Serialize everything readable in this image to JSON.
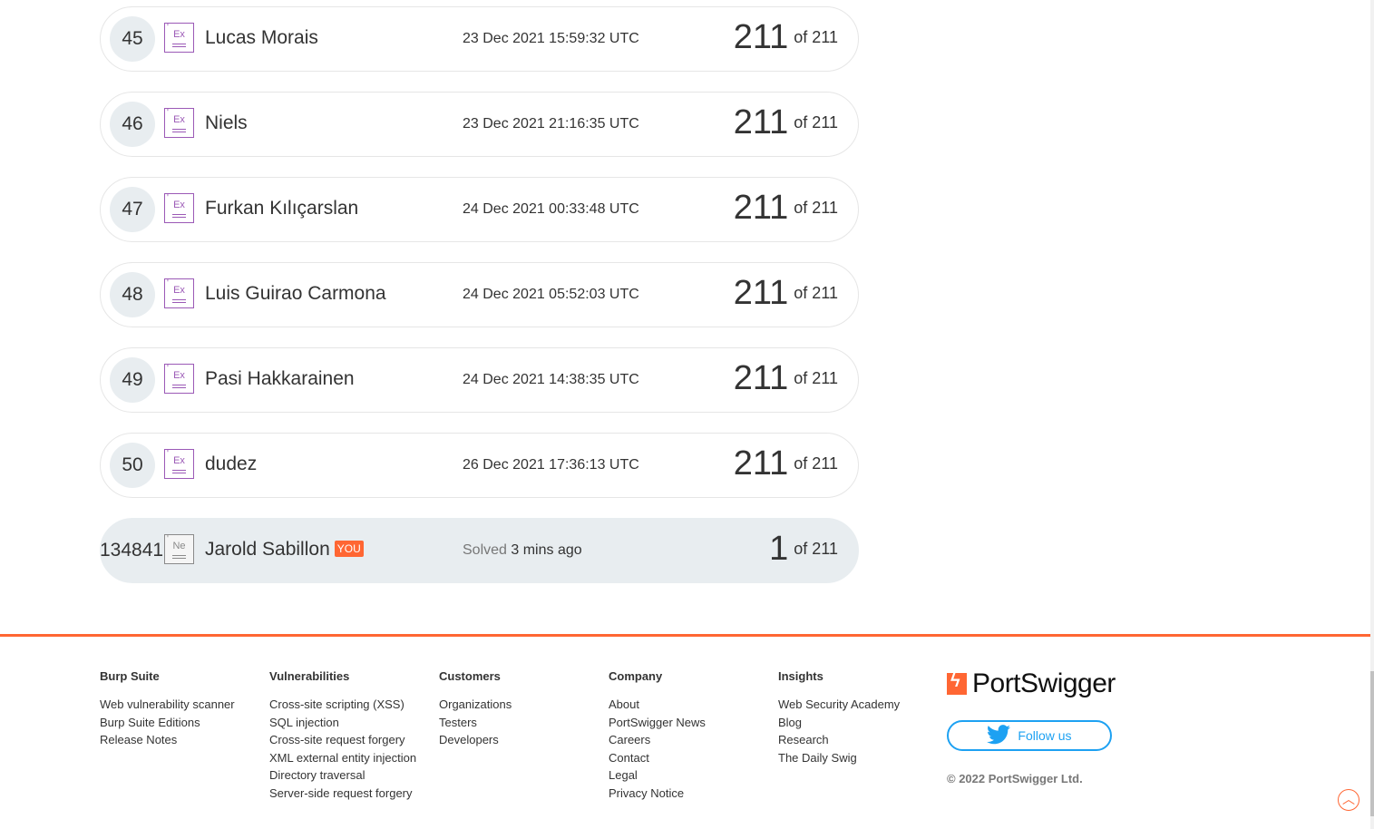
{
  "leaderboard": {
    "rows": [
      {
        "rank": "45",
        "level": "Ex",
        "name": "Lucas Morais",
        "date": "23 Dec 2021 15:59:32 UTC",
        "score": "211",
        "of": "of 211"
      },
      {
        "rank": "46",
        "level": "Ex",
        "name": "Niels",
        "date": "23 Dec 2021 21:16:35 UTC",
        "score": "211",
        "of": "of 211"
      },
      {
        "rank": "47",
        "level": "Ex",
        "name": "Furkan Kılıçarslan",
        "date": "24 Dec 2021 00:33:48 UTC",
        "score": "211",
        "of": "of 211"
      },
      {
        "rank": "48",
        "level": "Ex",
        "name": "Luis Guirao Carmona",
        "date": "24 Dec 2021 05:52:03 UTC",
        "score": "211",
        "of": "of 211"
      },
      {
        "rank": "49",
        "level": "Ex",
        "name": "Pasi Hakkarainen",
        "date": "24 Dec 2021 14:38:35 UTC",
        "score": "211",
        "of": "of 211"
      },
      {
        "rank": "50",
        "level": "Ex",
        "name": "dudez",
        "date": "26 Dec 2021 17:36:13 UTC",
        "score": "211",
        "of": "of 211"
      }
    ],
    "you": {
      "rank": "134841",
      "level": "Ne",
      "name": "Jarold Sabillon",
      "badge": "YOU",
      "solved_label": "Solved",
      "solved_time": "3 mins ago",
      "score": "1",
      "of": "of 211"
    }
  },
  "footer": {
    "burp": {
      "heading": "Burp Suite",
      "links": [
        "Web vulnerability scanner",
        "Burp Suite Editions",
        "Release Notes"
      ]
    },
    "vulns": {
      "heading": "Vulnerabilities",
      "links": [
        "Cross-site scripting (XSS)",
        "SQL injection",
        "Cross-site request forgery",
        "XML external entity injection",
        "Directory traversal",
        "Server-side request forgery"
      ]
    },
    "customers": {
      "heading": "Customers",
      "links": [
        "Organizations",
        "Testers",
        "Developers"
      ]
    },
    "company": {
      "heading": "Company",
      "links": [
        "About",
        "PortSwigger News",
        "Careers",
        "Contact",
        "Legal",
        "Privacy Notice"
      ]
    },
    "insights": {
      "heading": "Insights",
      "links": [
        "Web Security Academy",
        "Blog",
        "Research",
        "The Daily Swig"
      ]
    },
    "brand": {
      "name": "PortSwigger",
      "follow_label": "Follow us",
      "copyright": "© 2022 PortSwigger Ltd."
    }
  },
  "colors": {
    "accent": "#ff6633",
    "twitter": "#1da1f2",
    "expert": "#9b59b6"
  }
}
